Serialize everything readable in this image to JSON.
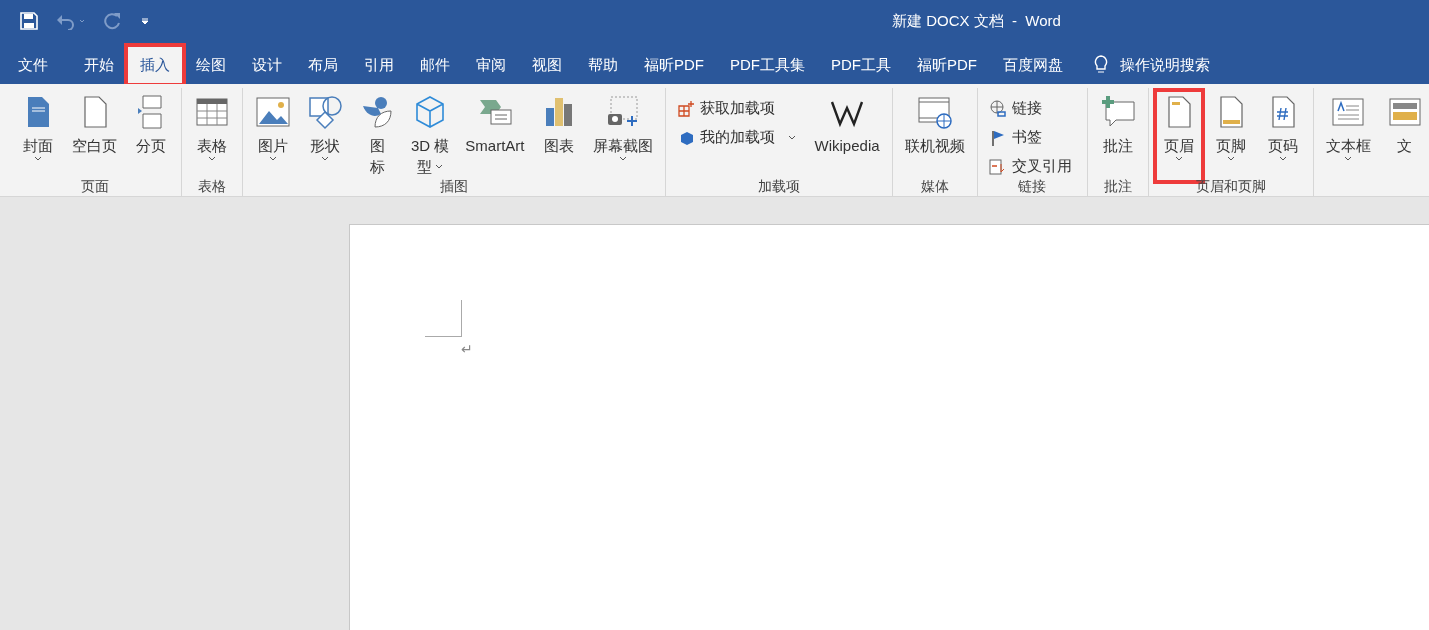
{
  "window": {
    "title": "新建 DOCX 文档  -  Word"
  },
  "tabs": [
    {
      "label": "文件",
      "selected": false,
      "highlighted": false
    },
    {
      "label": "开始",
      "selected": false,
      "highlighted": false
    },
    {
      "label": "插入",
      "selected": true,
      "highlighted": true
    },
    {
      "label": "绘图",
      "selected": false,
      "highlighted": false
    },
    {
      "label": "设计",
      "selected": false,
      "highlighted": false
    },
    {
      "label": "布局",
      "selected": false,
      "highlighted": false
    },
    {
      "label": "引用",
      "selected": false,
      "highlighted": false
    },
    {
      "label": "邮件",
      "selected": false,
      "highlighted": false
    },
    {
      "label": "审阅",
      "selected": false,
      "highlighted": false
    },
    {
      "label": "视图",
      "selected": false,
      "highlighted": false
    },
    {
      "label": "帮助",
      "selected": false,
      "highlighted": false
    },
    {
      "label": "福昕PDF",
      "selected": false,
      "highlighted": false
    },
    {
      "label": "PDF工具集",
      "selected": false,
      "highlighted": false
    },
    {
      "label": "PDF工具",
      "selected": false,
      "highlighted": false
    },
    {
      "label": "福昕PDF",
      "selected": false,
      "highlighted": false
    },
    {
      "label": "百度网盘",
      "selected": false,
      "highlighted": false
    }
  ],
  "tell_me": {
    "label": "操作说明搜索"
  },
  "ribbon_groups": [
    {
      "label": "页面",
      "items": [
        {
          "kind": "large",
          "lines": [
            "封面"
          ],
          "dropdown": true,
          "highlighted": false
        },
        {
          "kind": "large",
          "lines": [
            "空白页"
          ],
          "dropdown": false,
          "highlighted": false
        },
        {
          "kind": "large",
          "lines": [
            "分页"
          ],
          "dropdown": false,
          "highlighted": false
        }
      ]
    },
    {
      "label": "表格",
      "items": [
        {
          "kind": "large",
          "lines": [
            "表格"
          ],
          "dropdown": true,
          "highlighted": false
        }
      ]
    },
    {
      "label": "插图",
      "items": [
        {
          "kind": "large",
          "lines": [
            "图片"
          ],
          "dropdown": true,
          "highlighted": false
        },
        {
          "kind": "large",
          "lines": [
            "形状"
          ],
          "dropdown": true,
          "highlighted": false
        },
        {
          "kind": "large",
          "lines": [
            "图",
            "标"
          ],
          "dropdown": false,
          "highlighted": false
        },
        {
          "kind": "large",
          "lines": [
            "3D 模",
            "型"
          ],
          "dropdown": true,
          "highlighted": false
        },
        {
          "kind": "large",
          "lines": [
            "SmartArt"
          ],
          "dropdown": false,
          "highlighted": false
        },
        {
          "kind": "large",
          "lines": [
            "图表"
          ],
          "dropdown": false,
          "highlighted": false
        },
        {
          "kind": "large",
          "lines": [
            "屏幕截图"
          ],
          "dropdown": true,
          "highlighted": false
        }
      ]
    },
    {
      "label": "加载项",
      "items": [
        {
          "kind": "small",
          "lines": [
            "获取加载项"
          ],
          "dropdown": false,
          "highlighted": false
        },
        {
          "kind": "small",
          "lines": [
            "我的加载项"
          ],
          "dropdown": true,
          "highlighted": false
        },
        {
          "kind": "large",
          "lines": [
            "Wikipedia"
          ],
          "dropdown": false,
          "highlighted": false
        }
      ]
    },
    {
      "label": "媒体",
      "items": [
        {
          "kind": "large",
          "lines": [
            "联机视频"
          ],
          "dropdown": false,
          "highlighted": false
        }
      ]
    },
    {
      "label": "链接",
      "items": [
        {
          "kind": "small",
          "lines": [
            "链接"
          ],
          "dropdown": false,
          "highlighted": false
        },
        {
          "kind": "small",
          "lines": [
            "书签"
          ],
          "dropdown": false,
          "highlighted": false
        },
        {
          "kind": "small",
          "lines": [
            "交叉引用"
          ],
          "dropdown": false,
          "highlighted": false
        }
      ]
    },
    {
      "label": "批注",
      "items": [
        {
          "kind": "large",
          "lines": [
            "批注"
          ],
          "dropdown": false,
          "highlighted": false
        }
      ]
    },
    {
      "label": "页眉和页脚",
      "items": [
        {
          "kind": "large",
          "lines": [
            "页眉"
          ],
          "dropdown": true,
          "highlighted": true
        },
        {
          "kind": "large",
          "lines": [
            "页脚"
          ],
          "dropdown": true,
          "highlighted": false
        },
        {
          "kind": "large",
          "lines": [
            "页码"
          ],
          "dropdown": true,
          "highlighted": false
        }
      ]
    },
    {
      "items": [
        {
          "kind": "large",
          "lines": [
            "文本框"
          ],
          "dropdown": true,
          "highlighted": false
        },
        {
          "kind": "large",
          "lines": [
            "文"
          ],
          "dropdown": false,
          "highlighted": false
        }
      ]
    }
  ],
  "document": {
    "paragraph_mark": "↵"
  }
}
